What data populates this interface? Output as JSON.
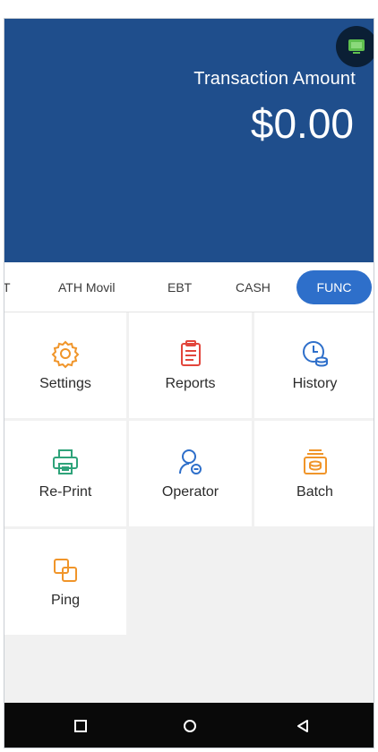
{
  "header": {
    "amount_label": "Transaction Amount",
    "amount_value": "$0.00",
    "colors": {
      "background": "#1f4e8c",
      "status_dot": "#0b1f35",
      "status_icon": "#5fbf4f"
    }
  },
  "tabs": [
    {
      "label": "T",
      "active": false
    },
    {
      "label": "ATH Movil",
      "active": false
    },
    {
      "label": "EBT",
      "active": false
    },
    {
      "label": "CASH",
      "active": false
    },
    {
      "label": "FUNC",
      "active": true
    }
  ],
  "functions": [
    {
      "label": "Settings",
      "icon": "gear-icon",
      "color": "#f0952a"
    },
    {
      "label": "Reports",
      "icon": "clipboard-icon",
      "color": "#e2463c"
    },
    {
      "label": "History",
      "icon": "clock-coins-icon",
      "color": "#2e6fca"
    },
    {
      "label": "Re-Print",
      "icon": "printer-icon",
      "color": "#2fa37a"
    },
    {
      "label": "Operator",
      "icon": "operator-icon",
      "color": "#2e6fca"
    },
    {
      "label": "Batch",
      "icon": "batch-icon",
      "color": "#f0952a"
    },
    {
      "label": "Ping",
      "icon": "ping-icon",
      "color": "#f0952a"
    }
  ],
  "navbar": {
    "buttons": [
      {
        "icon": "square-recents-icon"
      },
      {
        "icon": "circle-home-icon"
      },
      {
        "icon": "triangle-back-icon"
      }
    ]
  }
}
